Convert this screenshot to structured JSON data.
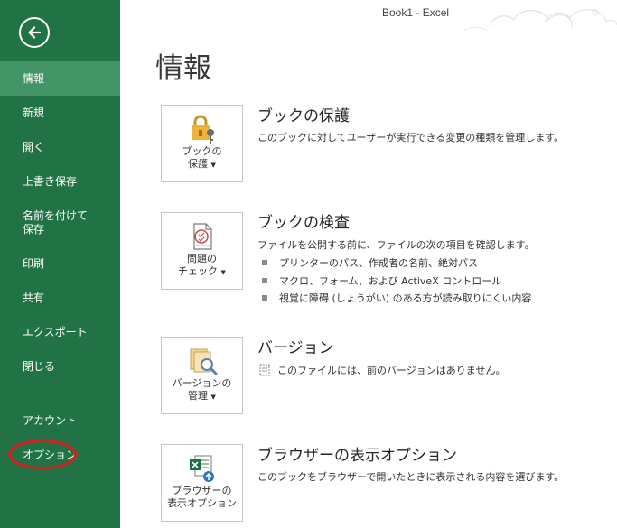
{
  "window": {
    "title": "Book1 - Excel"
  },
  "sidebar": {
    "back_icon": "back-arrow-icon",
    "items": [
      {
        "label": "情報",
        "active": true
      },
      {
        "label": "新規"
      },
      {
        "label": "開く"
      },
      {
        "label": "上書き保存"
      },
      {
        "label": "名前を付けて\n保存"
      },
      {
        "label": "印刷"
      },
      {
        "label": "共有"
      },
      {
        "label": "エクスポート"
      },
      {
        "label": "閉じる"
      },
      {
        "label": "アカウント"
      },
      {
        "label": "オプション",
        "highlighted": true
      }
    ],
    "bg_color": "#217346",
    "active_color": "#439467",
    "highlight_color": "#e11b22"
  },
  "main": {
    "page_title": "情報",
    "sections": [
      {
        "tile_label_1": "ブックの",
        "tile_label_2": "保護",
        "tile_icon": "lock-key-icon",
        "title": "ブックの保護",
        "description": "このブックに対してユーザーが実行できる変更の種類を管理します。"
      },
      {
        "tile_label_1": "問題の",
        "tile_label_2": "チェック",
        "tile_icon": "inspect-document-icon",
        "title": "ブックの検査",
        "description": "ファイルを公開する前に、ファイルの次の項目を確認します。",
        "bullets": [
          "プリンターのパス、作成者の名前、絶対パス",
          "マクロ、フォーム、および ActiveX コントロール",
          "視覚に障碍 (しょうがい) のある方が読み取りにくい内容"
        ]
      },
      {
        "tile_label_1": "バージョンの",
        "tile_label_2": "管理",
        "tile_icon": "manage-versions-icon",
        "title": "バージョン",
        "description": "このファイルには、前のバージョンはありません。"
      },
      {
        "tile_label_1": "ブラウザーの",
        "tile_label_2": "表示オプション",
        "tile_icon": "browser-view-options-icon",
        "title": "ブラウザーの表示オプション",
        "description": "このブックをブラウザーで開いたときに表示される内容を選びます。"
      }
    ]
  }
}
